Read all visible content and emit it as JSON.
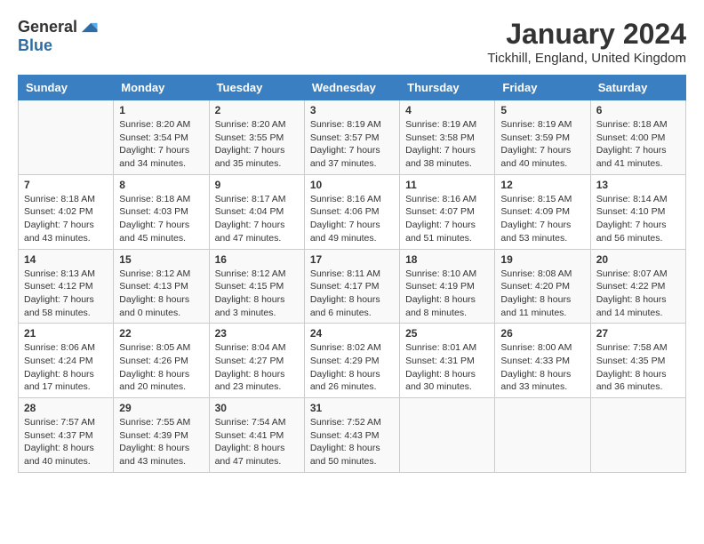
{
  "logo": {
    "general": "General",
    "blue": "Blue"
  },
  "title": "January 2024",
  "location": "Tickhill, England, United Kingdom",
  "days_of_week": [
    "Sunday",
    "Monday",
    "Tuesday",
    "Wednesday",
    "Thursday",
    "Friday",
    "Saturday"
  ],
  "weeks": [
    [
      {
        "day": "",
        "info": ""
      },
      {
        "day": "1",
        "info": "Sunrise: 8:20 AM\nSunset: 3:54 PM\nDaylight: 7 hours\nand 34 minutes."
      },
      {
        "day": "2",
        "info": "Sunrise: 8:20 AM\nSunset: 3:55 PM\nDaylight: 7 hours\nand 35 minutes."
      },
      {
        "day": "3",
        "info": "Sunrise: 8:19 AM\nSunset: 3:57 PM\nDaylight: 7 hours\nand 37 minutes."
      },
      {
        "day": "4",
        "info": "Sunrise: 8:19 AM\nSunset: 3:58 PM\nDaylight: 7 hours\nand 38 minutes."
      },
      {
        "day": "5",
        "info": "Sunrise: 8:19 AM\nSunset: 3:59 PM\nDaylight: 7 hours\nand 40 minutes."
      },
      {
        "day": "6",
        "info": "Sunrise: 8:18 AM\nSunset: 4:00 PM\nDaylight: 7 hours\nand 41 minutes."
      }
    ],
    [
      {
        "day": "7",
        "info": "Sunrise: 8:18 AM\nSunset: 4:02 PM\nDaylight: 7 hours\nand 43 minutes."
      },
      {
        "day": "8",
        "info": "Sunrise: 8:18 AM\nSunset: 4:03 PM\nDaylight: 7 hours\nand 45 minutes."
      },
      {
        "day": "9",
        "info": "Sunrise: 8:17 AM\nSunset: 4:04 PM\nDaylight: 7 hours\nand 47 minutes."
      },
      {
        "day": "10",
        "info": "Sunrise: 8:16 AM\nSunset: 4:06 PM\nDaylight: 7 hours\nand 49 minutes."
      },
      {
        "day": "11",
        "info": "Sunrise: 8:16 AM\nSunset: 4:07 PM\nDaylight: 7 hours\nand 51 minutes."
      },
      {
        "day": "12",
        "info": "Sunrise: 8:15 AM\nSunset: 4:09 PM\nDaylight: 7 hours\nand 53 minutes."
      },
      {
        "day": "13",
        "info": "Sunrise: 8:14 AM\nSunset: 4:10 PM\nDaylight: 7 hours\nand 56 minutes."
      }
    ],
    [
      {
        "day": "14",
        "info": "Sunrise: 8:13 AM\nSunset: 4:12 PM\nDaylight: 7 hours\nand 58 minutes."
      },
      {
        "day": "15",
        "info": "Sunrise: 8:12 AM\nSunset: 4:13 PM\nDaylight: 8 hours\nand 0 minutes."
      },
      {
        "day": "16",
        "info": "Sunrise: 8:12 AM\nSunset: 4:15 PM\nDaylight: 8 hours\nand 3 minutes."
      },
      {
        "day": "17",
        "info": "Sunrise: 8:11 AM\nSunset: 4:17 PM\nDaylight: 8 hours\nand 6 minutes."
      },
      {
        "day": "18",
        "info": "Sunrise: 8:10 AM\nSunset: 4:19 PM\nDaylight: 8 hours\nand 8 minutes."
      },
      {
        "day": "19",
        "info": "Sunrise: 8:08 AM\nSunset: 4:20 PM\nDaylight: 8 hours\nand 11 minutes."
      },
      {
        "day": "20",
        "info": "Sunrise: 8:07 AM\nSunset: 4:22 PM\nDaylight: 8 hours\nand 14 minutes."
      }
    ],
    [
      {
        "day": "21",
        "info": "Sunrise: 8:06 AM\nSunset: 4:24 PM\nDaylight: 8 hours\nand 17 minutes."
      },
      {
        "day": "22",
        "info": "Sunrise: 8:05 AM\nSunset: 4:26 PM\nDaylight: 8 hours\nand 20 minutes."
      },
      {
        "day": "23",
        "info": "Sunrise: 8:04 AM\nSunset: 4:27 PM\nDaylight: 8 hours\nand 23 minutes."
      },
      {
        "day": "24",
        "info": "Sunrise: 8:02 AM\nSunset: 4:29 PM\nDaylight: 8 hours\nand 26 minutes."
      },
      {
        "day": "25",
        "info": "Sunrise: 8:01 AM\nSunset: 4:31 PM\nDaylight: 8 hours\nand 30 minutes."
      },
      {
        "day": "26",
        "info": "Sunrise: 8:00 AM\nSunset: 4:33 PM\nDaylight: 8 hours\nand 33 minutes."
      },
      {
        "day": "27",
        "info": "Sunrise: 7:58 AM\nSunset: 4:35 PM\nDaylight: 8 hours\nand 36 minutes."
      }
    ],
    [
      {
        "day": "28",
        "info": "Sunrise: 7:57 AM\nSunset: 4:37 PM\nDaylight: 8 hours\nand 40 minutes."
      },
      {
        "day": "29",
        "info": "Sunrise: 7:55 AM\nSunset: 4:39 PM\nDaylight: 8 hours\nand 43 minutes."
      },
      {
        "day": "30",
        "info": "Sunrise: 7:54 AM\nSunset: 4:41 PM\nDaylight: 8 hours\nand 47 minutes."
      },
      {
        "day": "31",
        "info": "Sunrise: 7:52 AM\nSunset: 4:43 PM\nDaylight: 8 hours\nand 50 minutes."
      },
      {
        "day": "",
        "info": ""
      },
      {
        "day": "",
        "info": ""
      },
      {
        "day": "",
        "info": ""
      }
    ]
  ]
}
